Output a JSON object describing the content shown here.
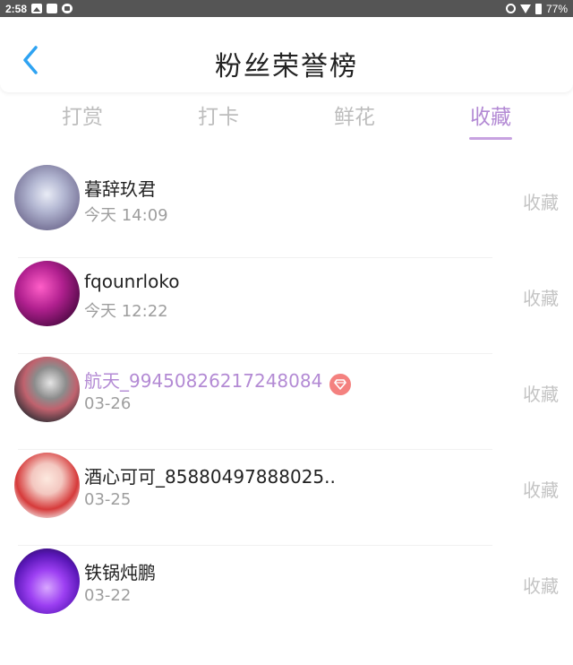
{
  "status_bar": {
    "time": "2:58",
    "battery": "77%",
    "left_icons": [
      "image-icon",
      "square-icon",
      "app-icon"
    ],
    "right_icons": [
      "alarm-icon",
      "wifi-icon",
      "battery-icon"
    ]
  },
  "header": {
    "title": "粉丝荣誉榜",
    "back_icon": "chevron-left-icon",
    "back_color": "#2ea3f2"
  },
  "tabs": [
    {
      "label": "打赏",
      "active": false
    },
    {
      "label": "打卡",
      "active": false
    },
    {
      "label": "鲜花",
      "active": false
    },
    {
      "label": "收藏",
      "active": true
    }
  ],
  "colors": {
    "accent": "#b38ad4",
    "inactive_tab": "#bdbdbd",
    "secondary_text": "#9e9e9e",
    "action_text": "#c4c4c4",
    "badge": "#f4817f"
  },
  "list": [
    {
      "name": "暮辞玖君",
      "time": "今天 14:09",
      "action": "收藏",
      "highlight": false,
      "badge": false
    },
    {
      "name": "fqounrloko",
      "time": "今天 12:22",
      "action": "收藏",
      "highlight": false,
      "badge": false
    },
    {
      "name": "航天_9945082621724808­4",
      "time": "03-26",
      "action": "收藏",
      "highlight": true,
      "badge": true,
      "badge_icon": "diamond-icon"
    },
    {
      "name": "酒心可可_85880497888025..",
      "time": "03-25",
      "action": "收藏",
      "highlight": false,
      "badge": false
    },
    {
      "name": "铁锅炖鹏",
      "time": "03-22",
      "action": "收藏",
      "highlight": false,
      "badge": false
    }
  ]
}
